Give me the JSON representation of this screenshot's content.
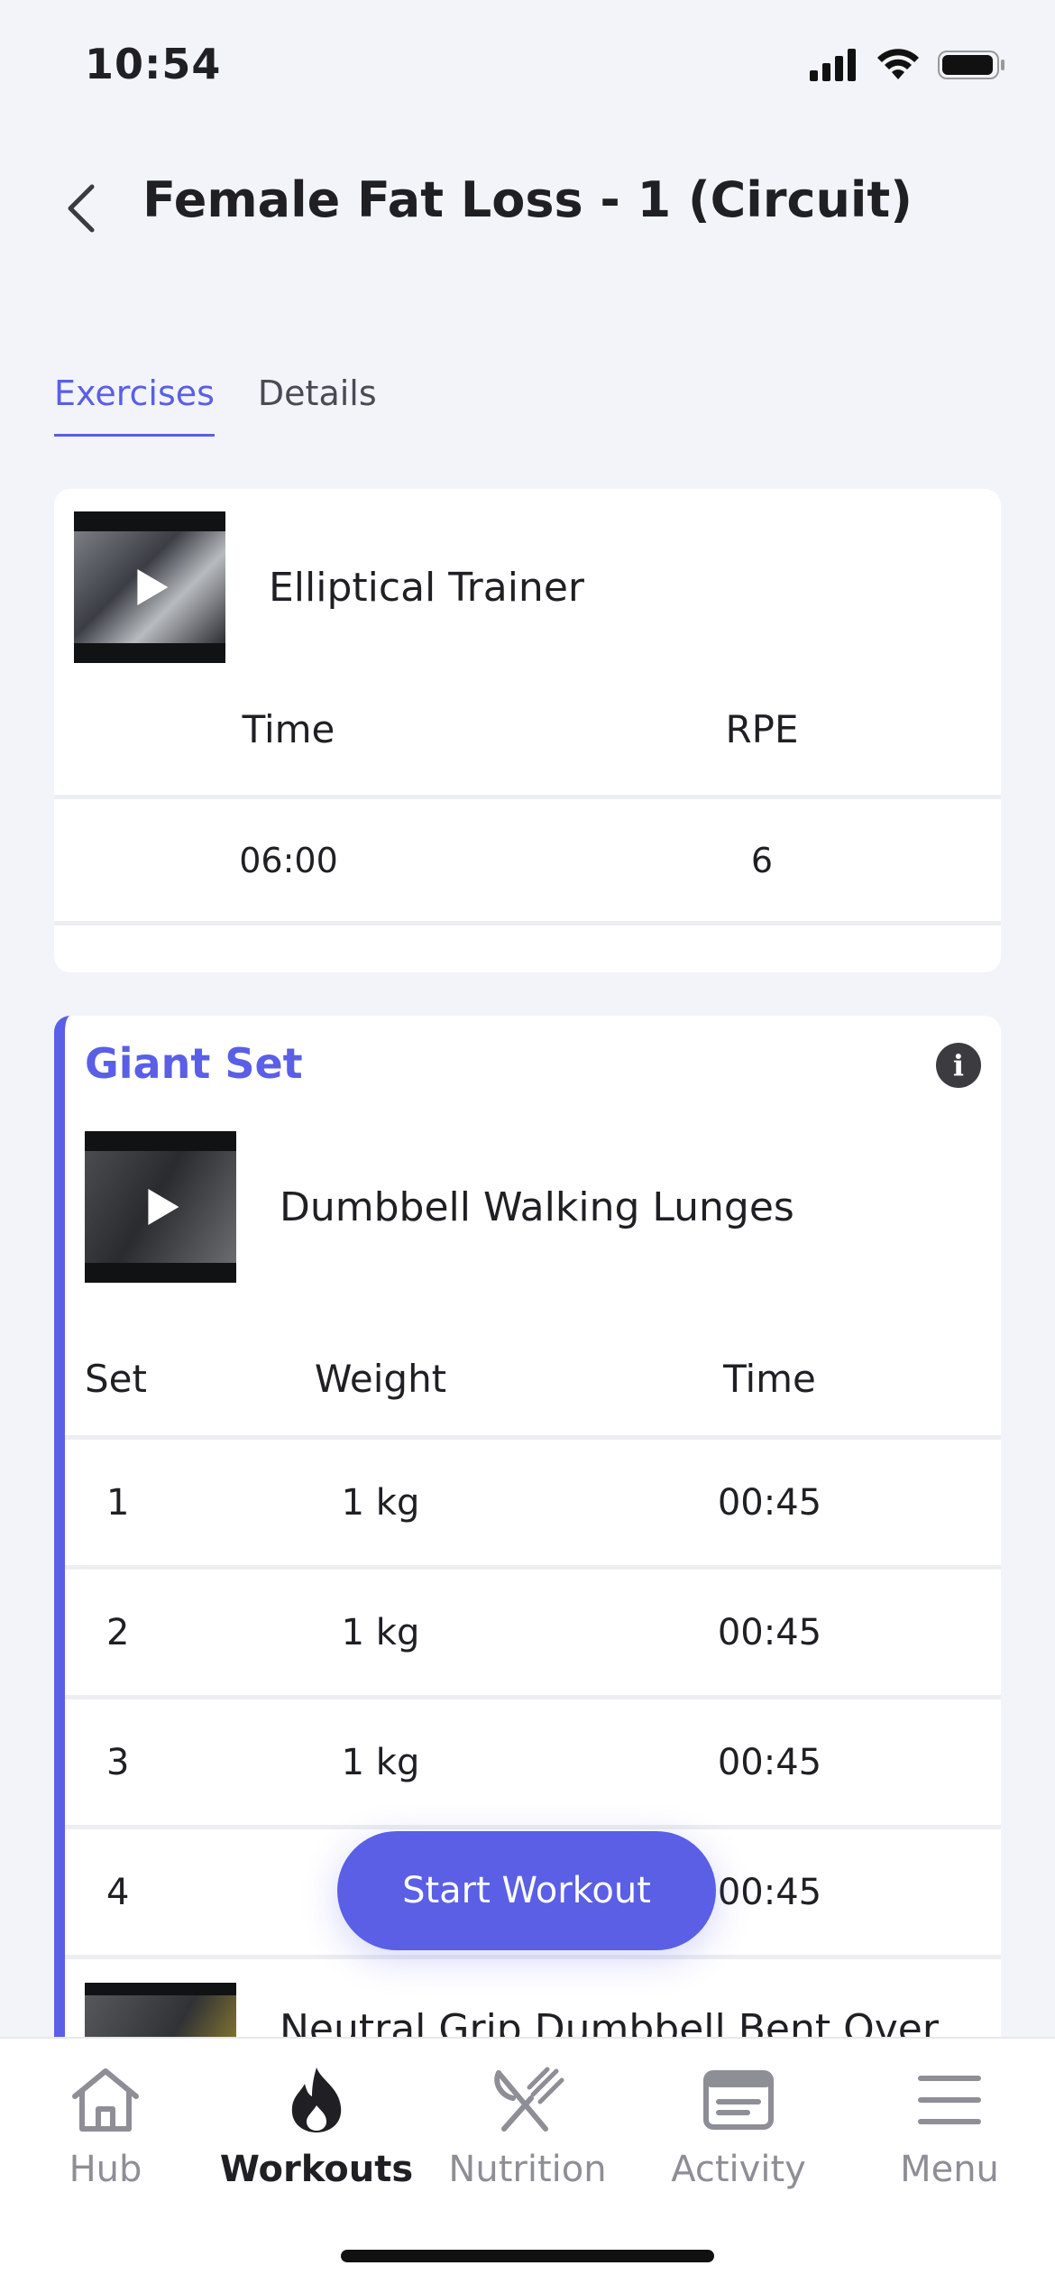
{
  "status": {
    "time": "10:54"
  },
  "header": {
    "title": "Female Fat Loss - 1 (Circuit)"
  },
  "tabs": [
    {
      "label": "Exercises",
      "active": true
    },
    {
      "label": "Details",
      "active": false
    }
  ],
  "exercise1": {
    "name": "Elliptical Trainer",
    "columns": [
      "Time",
      "RPE"
    ],
    "rows": [
      [
        "06:00",
        "6"
      ]
    ]
  },
  "giant_set": {
    "title": "Giant Set",
    "exercise": {
      "name": "Dumbbell Walking Lunges",
      "columns": [
        "Set",
        "Weight",
        "Time"
      ],
      "rows": [
        [
          "1",
          "1 kg",
          "00:45"
        ],
        [
          "2",
          "1 kg",
          "00:45"
        ],
        [
          "3",
          "1 kg",
          "00:45"
        ],
        [
          "4",
          "",
          "00:45"
        ]
      ]
    },
    "next_exercise": {
      "name": "Neutral Grip Dumbbell Bent Over"
    }
  },
  "start_button": "Start Workout",
  "nav": [
    {
      "label": "Hub",
      "icon": "home-icon",
      "active": false
    },
    {
      "label": "Workouts",
      "icon": "flame-icon",
      "active": true
    },
    {
      "label": "Nutrition",
      "icon": "fork-knife-icon",
      "active": false
    },
    {
      "label": "Activity",
      "icon": "activity-card-icon",
      "active": false
    },
    {
      "label": "Menu",
      "icon": "hamburger-menu-icon",
      "active": false
    }
  ],
  "colors": {
    "accent": "#5a5fe6",
    "background": "#f2f4f9"
  }
}
